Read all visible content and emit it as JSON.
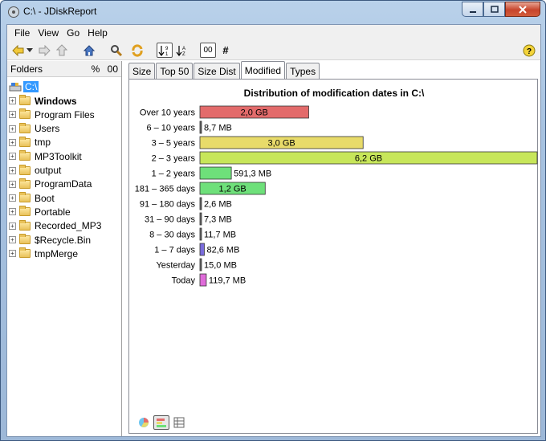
{
  "window": {
    "title": "C:\\ - JDiskReport"
  },
  "menu": [
    "File",
    "View",
    "Go",
    "Help"
  ],
  "toolbar": {
    "sort_label": "00",
    "count_symbol": "#"
  },
  "folders_pane": {
    "title": "Folders",
    "percent_label": "%",
    "size_label": "00",
    "root": "C:\\",
    "items": [
      {
        "label": "Windows",
        "bold": true
      },
      {
        "label": "Program Files",
        "bold": false
      },
      {
        "label": "Users",
        "bold": false
      },
      {
        "label": "tmp",
        "bold": false
      },
      {
        "label": "MP3Toolkit",
        "bold": false
      },
      {
        "label": "output",
        "bold": false
      },
      {
        "label": "ProgramData",
        "bold": false
      },
      {
        "label": "Boot",
        "bold": false
      },
      {
        "label": "Portable",
        "bold": false
      },
      {
        "label": "Recorded_MP3",
        "bold": false
      },
      {
        "label": "$Recycle.Bin",
        "bold": false
      },
      {
        "label": "tmpMerge",
        "bold": false
      }
    ]
  },
  "tabs": [
    "Size",
    "Top 50",
    "Size Dist",
    "Modified",
    "Types"
  ],
  "active_tab": "Modified",
  "chart_data": {
    "type": "bar",
    "orientation": "horizontal",
    "title": "Distribution of modification dates in C:\\",
    "categories": [
      "Over 10 years",
      "6 – 10 years",
      "3 – 5 years",
      "2 – 3 years",
      "1 – 2 years",
      "181 – 365 days",
      "91 – 180 days",
      "31 – 90 days",
      "8 – 30 days",
      "1 – 7 days",
      "Yesterday",
      "Today"
    ],
    "values_mb": [
      2048,
      8.7,
      3072,
      6348.8,
      591.3,
      1228.8,
      2.6,
      7.3,
      11.7,
      82.6,
      15.0,
      119.7
    ],
    "value_labels": [
      "2,0 GB",
      "8,7 MB",
      "3,0 GB",
      "6,2 GB",
      "591,3 MB",
      "1,2 GB",
      "2,6 MB",
      "7,3 MB",
      "11,7 MB",
      "82,6 MB",
      "15,0 MB",
      "119,7 MB"
    ],
    "label_inside": [
      true,
      false,
      true,
      true,
      false,
      true,
      false,
      false,
      false,
      false,
      false,
      false
    ],
    "colors": [
      "#e36b6b",
      "#6c6c6c",
      "#e8db6a",
      "#c7e65a",
      "#6ee07a",
      "#6ee07a",
      "#6c6c6c",
      "#6c6c6c",
      "#6c6c6c",
      "#7a6cdc",
      "#6c6c6c",
      "#df6bd9"
    ]
  },
  "colors": {
    "titlebar": "#b9d1ea",
    "selection": "#3399ff"
  }
}
